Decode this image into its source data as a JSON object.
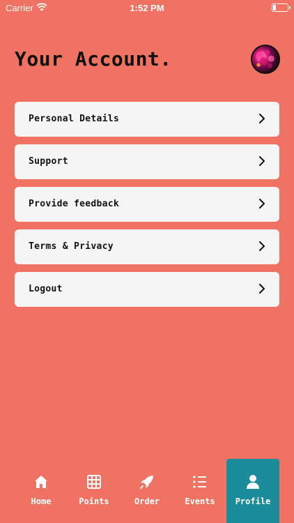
{
  "status_bar": {
    "carrier": "Carrier",
    "time": "1:52 PM",
    "battery_level": 0.2
  },
  "header": {
    "title": "Your Account."
  },
  "menu": {
    "items": [
      {
        "label": "Personal Details",
        "icon": "chevron-right-icon"
      },
      {
        "label": "Support",
        "icon": "chevron-right-icon"
      },
      {
        "label": "Provide feedback",
        "icon": "chevron-right-icon"
      },
      {
        "label": "Terms & Privacy",
        "icon": "chevron-right-icon"
      },
      {
        "label": "Logout",
        "icon": "chevron-right-icon"
      }
    ]
  },
  "tab_bar": {
    "tabs": [
      {
        "label": "Home",
        "icon": "home-icon",
        "active": false
      },
      {
        "label": "Points",
        "icon": "grid-icon",
        "active": false
      },
      {
        "label": "Order",
        "icon": "rocket-icon",
        "active": false
      },
      {
        "label": "Events",
        "icon": "list-icon",
        "active": false
      },
      {
        "label": "Profile",
        "icon": "profile-icon",
        "active": true
      }
    ]
  },
  "colors": {
    "background": "#ef7262",
    "card": "#f5f5f5",
    "active_tab": "#1a8c9c",
    "text": "#111111"
  }
}
